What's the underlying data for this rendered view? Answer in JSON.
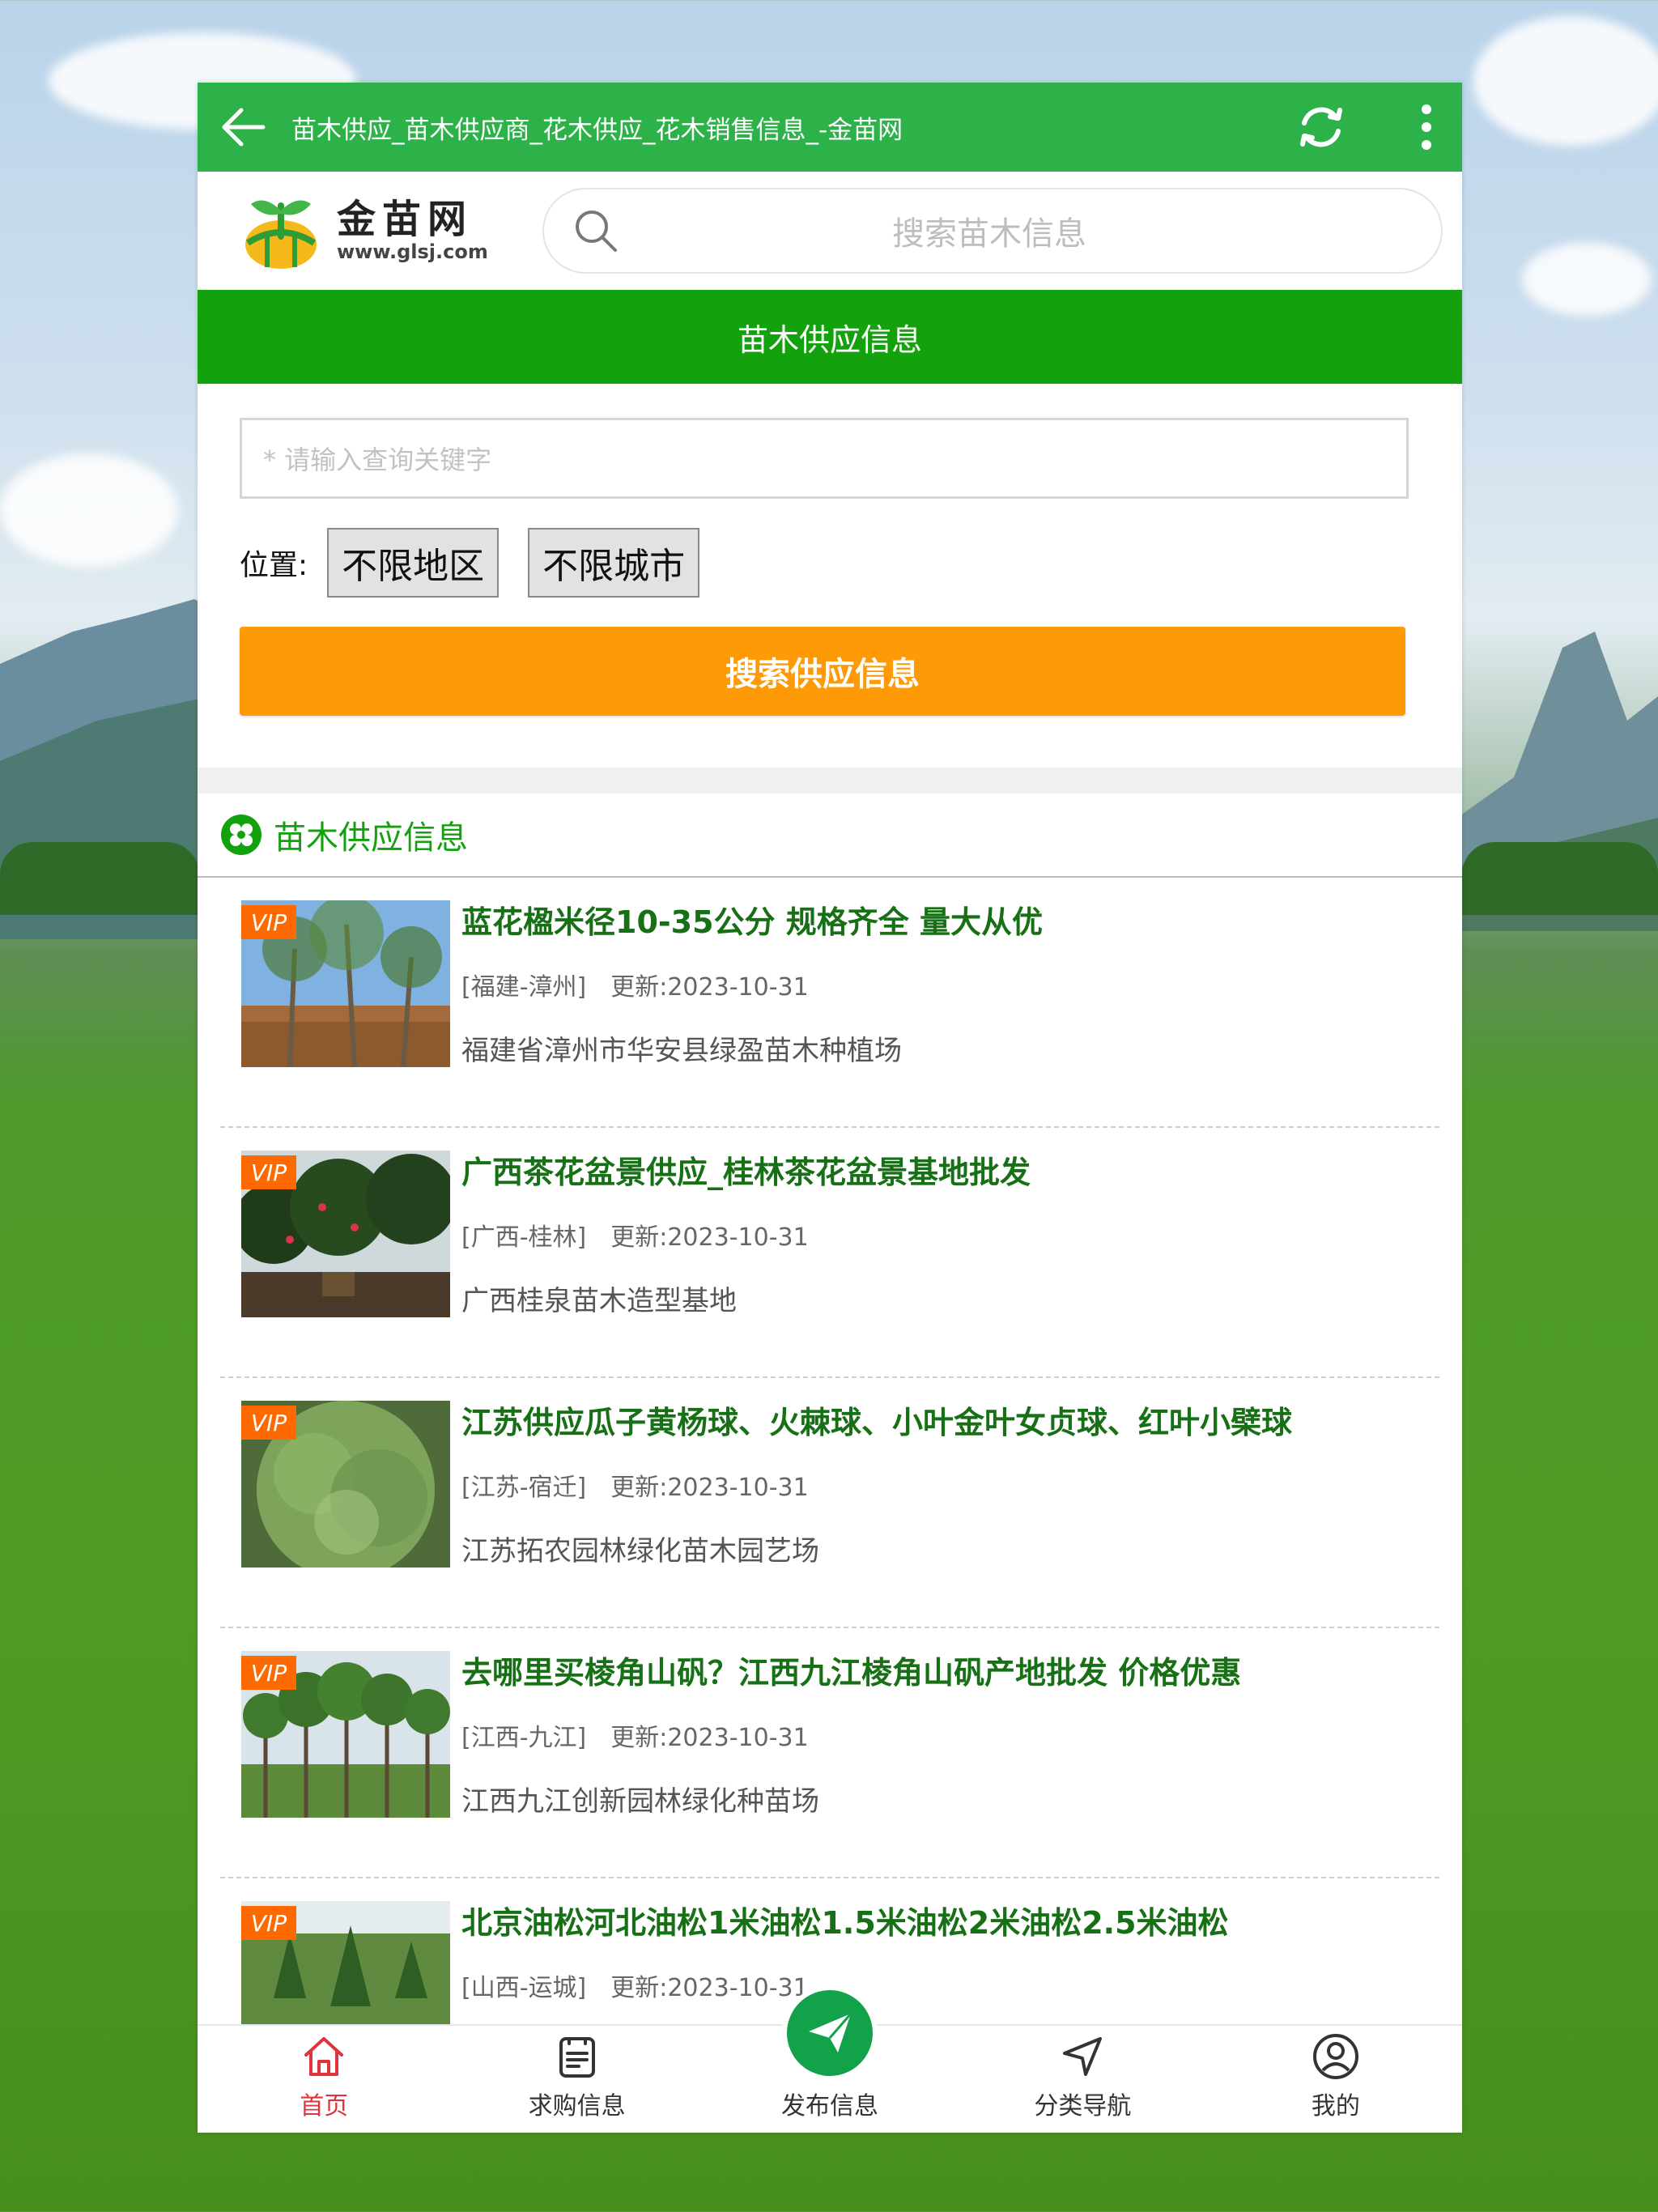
{
  "browser": {
    "title": "苗木供应_苗木供应商_花木供应_花木销售信息_-金苗网"
  },
  "logo": {
    "cn": "金苗网",
    "en": "www.glsj.com"
  },
  "search": {
    "placeholder": "搜索苗木信息"
  },
  "banner": {
    "title": "苗木供应信息"
  },
  "form": {
    "keyword_placeholder": "* 请输入查询关键字",
    "location_label": "位置:",
    "region_select": "不限地区",
    "city_select": "不限城市",
    "submit_label": "搜索供应信息"
  },
  "list": {
    "heading": "苗木供应信息",
    "items": [
      {
        "badge": "VIP",
        "title": "蓝花楹米径10-35公分 规格齐全 量大从优",
        "region": "[福建-漳州]",
        "updated": "更新:2023-10-31",
        "company": "福建省漳州市华安县绿盈苗木种植场"
      },
      {
        "badge": "VIP",
        "title": "广西茶花盆景供应_桂林茶花盆景基地批发",
        "region": "[广西-桂林]",
        "updated": "更新:2023-10-31",
        "company": "广西桂泉苗木造型基地"
      },
      {
        "badge": "VIP",
        "title": "江苏供应瓜子黄杨球、火棘球、小叶金叶女贞球、红叶小檗球",
        "region": "[江苏-宿迁]",
        "updated": "更新:2023-10-31",
        "company": "江苏拓农园林绿化苗木园艺场"
      },
      {
        "badge": "VIP",
        "title": "去哪里买棱角山矾？江西九江棱角山矾产地批发 价格优惠",
        "region": "[江西-九江]",
        "updated": "更新:2023-10-31",
        "company": "江西九江创新园林绿化种苗场"
      },
      {
        "badge": "VIP",
        "title": "北京油松河北油松1米油松1.5米油松2米油松2.5米油松",
        "region": "[山西-运城]",
        "updated": "更新:2023-10-31",
        "company": ""
      }
    ]
  },
  "tabbar": {
    "home": "首页",
    "buy": "求购信息",
    "post": "发布信息",
    "category": "分类导航",
    "mine": "我的"
  },
  "colors": {
    "topbar": "#2db24a",
    "banner": "#13a10e",
    "submit": "#fe9a05",
    "vip": "#ff6a00",
    "title_text": "#177015",
    "active_tab": "#e0333b"
  }
}
